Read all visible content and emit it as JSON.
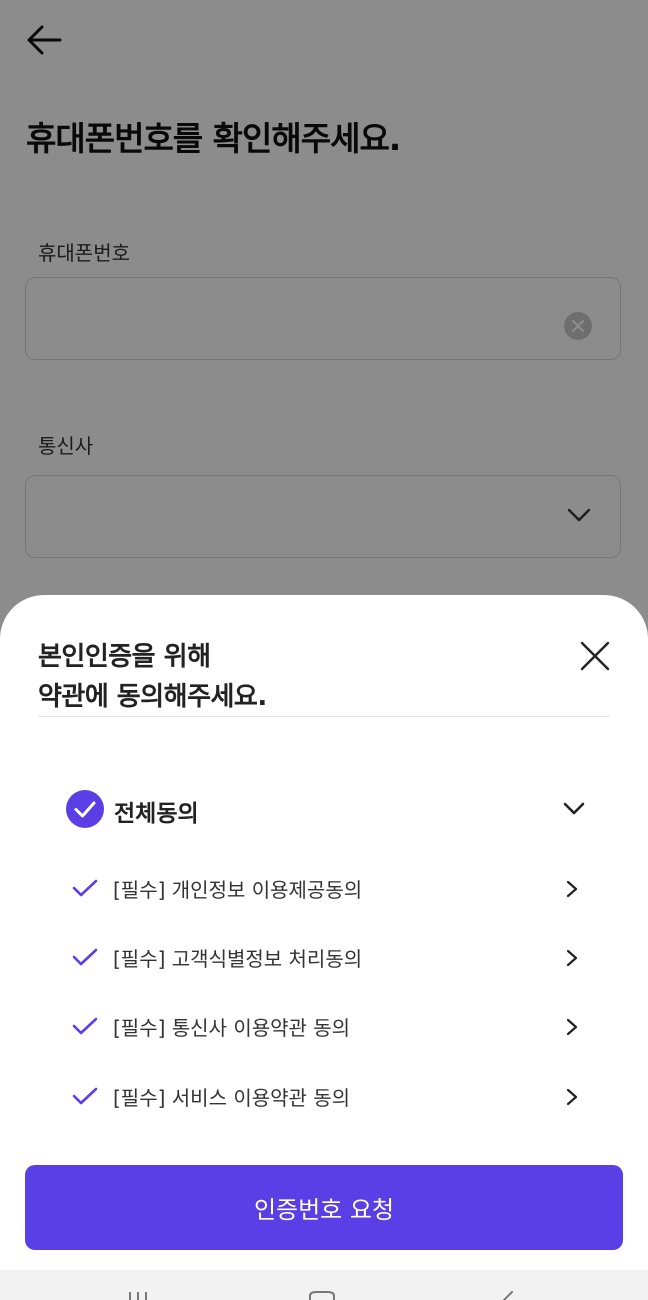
{
  "header": {
    "back_icon": "arrow-left-icon"
  },
  "page": {
    "title": "휴대폰번호를 확인해주세요."
  },
  "phone": {
    "label": "휴대폰번호",
    "value": "",
    "clear_icon": "clear-circle-icon"
  },
  "carrier": {
    "label": "통신사",
    "value": "",
    "chevron_icon": "chevron-down-icon"
  },
  "sheet": {
    "title_line1": "본인인증을 위해",
    "title_line2": "약관에 동의해주세요.",
    "close_icon": "close-icon",
    "all_agree": {
      "label": "전체동의",
      "checked": true,
      "expand_icon": "chevron-down-icon"
    },
    "terms": [
      {
        "label": "[필수] 개인정보 이용제공동의",
        "checked": true
      },
      {
        "label": "[필수] 고객식별정보 처리동의",
        "checked": true
      },
      {
        "label": "[필수] 통신사 이용약관 동의",
        "checked": true
      },
      {
        "label": "[필수] 서비스 이용약관 동의",
        "checked": true
      }
    ]
  },
  "cta": {
    "label": "인증번호 요청"
  },
  "nav": {
    "items": [
      "recent-apps-icon",
      "home-icon",
      "back-icon"
    ]
  },
  "colors": {
    "accent": "#5a3ee6",
    "overlay": "rgba(0,0,0,0.45)"
  }
}
